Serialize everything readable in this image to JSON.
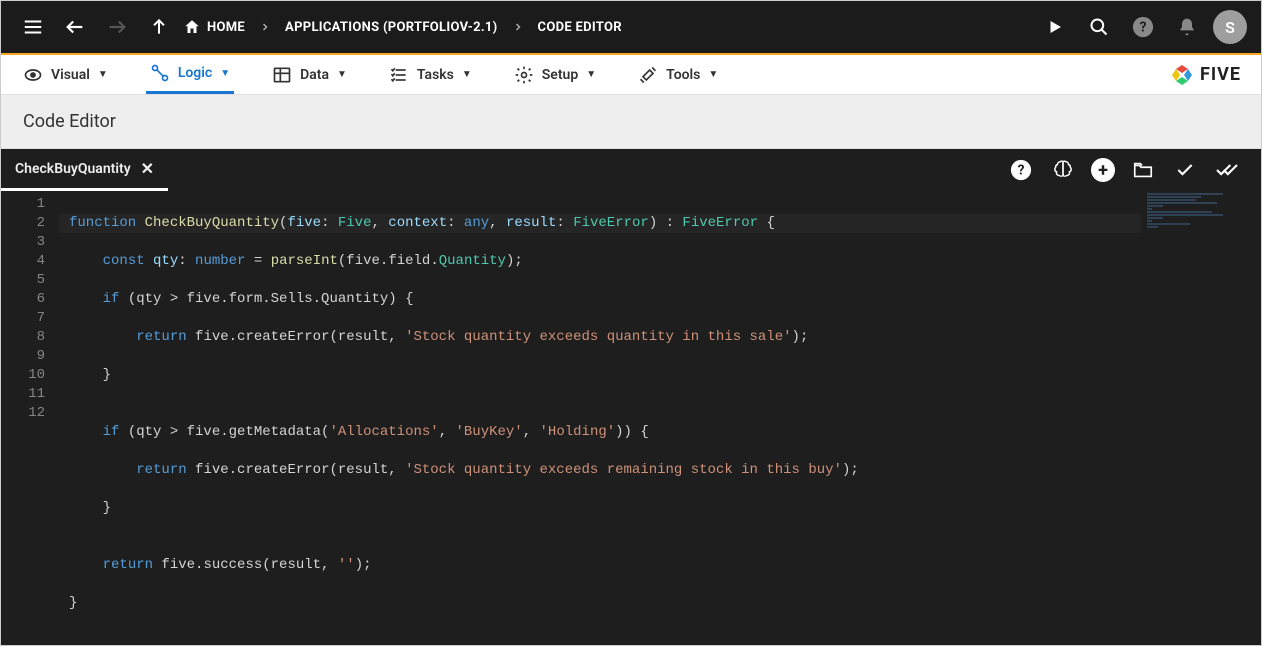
{
  "breadcrumb": {
    "home": "HOME",
    "applications": "APPLICATIONS (PORTFOLIOV-2.1)",
    "editor": "CODE EDITOR"
  },
  "avatar_initial": "S",
  "tabs": {
    "visual": "Visual",
    "logic": "Logic",
    "data": "Data",
    "tasks": "Tasks",
    "setup": "Setup",
    "tools": "Tools"
  },
  "brand": "FIVE",
  "section_title": "Code Editor",
  "editor_tab": "CheckBuyQuantity",
  "line_numbers": [
    "1",
    "2",
    "3",
    "4",
    "5",
    "6",
    "7",
    "8",
    "9",
    "10",
    "11",
    "12"
  ],
  "code": {
    "l1": {
      "kw_function": "function",
      "fn_name": "CheckBuyQuantity",
      "p_open": "(",
      "arg1_name": "five",
      "colon1": ": ",
      "arg1_type": "Five",
      "comma1": ", ",
      "arg2_name": "context",
      "colon2": ": ",
      "arg2_type": "any",
      "comma2": ", ",
      "arg3_name": "result",
      "colon3": ": ",
      "arg3_type": "FiveError",
      "p_close": ") : ",
      "ret_type": "FiveError",
      "brace": " {"
    },
    "l2_pre": "    ",
    "l2_const": "const",
    "l2_var": " qty",
    "l2_colon": ": ",
    "l2_type": "number",
    "l2_eq": " = ",
    "l2_fn": "parseInt",
    "l2_open": "(five.field.",
    "l2_field": "Quantity",
    "l2_close": ");",
    "l3_pre": "    ",
    "l3_if": "if",
    "l3_cond": " (qty > five.form.Sells.Quantity) {",
    "l4_pre": "        ",
    "l4_return": "return",
    "l4_call": " five.createError(result, ",
    "l4_str": "'Stock quantity exceeds quantity in this sale'",
    "l4_end": ");",
    "l5": "    }",
    "l6": "",
    "l7_pre": "    ",
    "l7_if": "if",
    "l7_open": " (qty > five.getMetadata(",
    "l7_s1": "'Allocations'",
    "l7_c1": ", ",
    "l7_s2": "'BuyKey'",
    "l7_c2": ", ",
    "l7_s3": "'Holding'",
    "l7_close": ")) {",
    "l8_pre": "        ",
    "l8_return": "return",
    "l8_call": " five.createError(result, ",
    "l8_str": "'Stock quantity exceeds remaining stock in this buy'",
    "l8_end": ");",
    "l9": "    }",
    "l10": "",
    "l11_pre": "    ",
    "l11_return": "return",
    "l11_call": " five.success(result, ",
    "l11_str": "''",
    "l11_end": ");",
    "l12": "}"
  }
}
